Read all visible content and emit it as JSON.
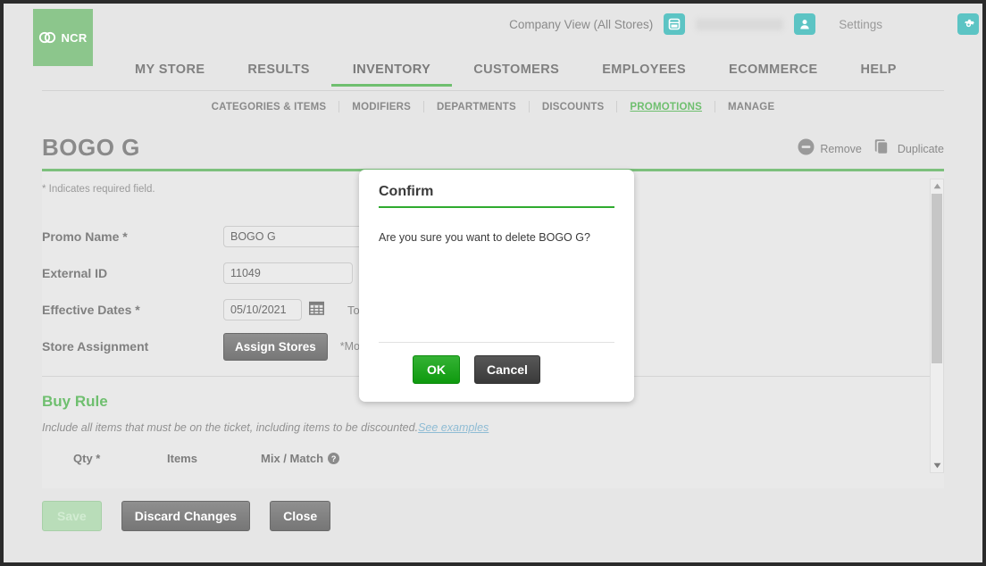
{
  "header": {
    "logo_text": "NCR",
    "company_view": "Company View (All Stores)",
    "settings_label": "Settings",
    "store_icon": "store-icon",
    "user_icon": "user-icon",
    "gear_icon": "gear-icon"
  },
  "mainnav": {
    "items": [
      {
        "label": "MY STORE",
        "active": false
      },
      {
        "label": "RESULTS",
        "active": false
      },
      {
        "label": "INVENTORY",
        "active": true
      },
      {
        "label": "CUSTOMERS",
        "active": false
      },
      {
        "label": "EMPLOYEES",
        "active": false
      },
      {
        "label": "ECOMMERCE",
        "active": false
      },
      {
        "label": "HELP",
        "active": false
      }
    ]
  },
  "subnav": {
    "items": [
      {
        "label": "CATEGORIES & ITEMS",
        "active": false
      },
      {
        "label": "MODIFIERS",
        "active": false
      },
      {
        "label": "DEPARTMENTS",
        "active": false
      },
      {
        "label": "DISCOUNTS",
        "active": false
      },
      {
        "label": "PROMOTIONS",
        "active": true
      },
      {
        "label": "MANAGE",
        "active": false
      }
    ]
  },
  "page": {
    "title": "BOGO G",
    "remove_label": "Remove",
    "duplicate_label": "Duplicate",
    "required_note": "* Indicates required field."
  },
  "form": {
    "promo_name_label": "Promo Name *",
    "promo_name_value": "BOGO G",
    "external_id_label": "External ID",
    "external_id_value": "11049",
    "effective_dates_label": "Effective Dates *",
    "effective_date_start": "05/10/2021",
    "to_label": "To",
    "store_assignment_label": "Store Assignment",
    "assign_stores_button": "Assign Stores",
    "store_note": "*Mon"
  },
  "buy_rule": {
    "section_title": "Buy Rule",
    "help_text": "Include all items that must be on the ticket, including items to be discounted.",
    "help_link": "See examples",
    "columns": [
      "Qty *",
      "Items",
      "Mix / Match"
    ]
  },
  "footer": {
    "save_label": "Save",
    "discard_label": "Discard Changes",
    "close_label": "Close"
  },
  "modal": {
    "title": "Confirm",
    "message": "Are you sure you want to delete BOGO G?",
    "ok_label": "OK",
    "cancel_label": "Cancel"
  },
  "colors": {
    "brand_green": "#6fbf6f",
    "logo_green": "#8cc68c",
    "teal": "#5cc4c4",
    "ok_green": "#1a9e1a",
    "page_bg": "#e6e6e6"
  }
}
